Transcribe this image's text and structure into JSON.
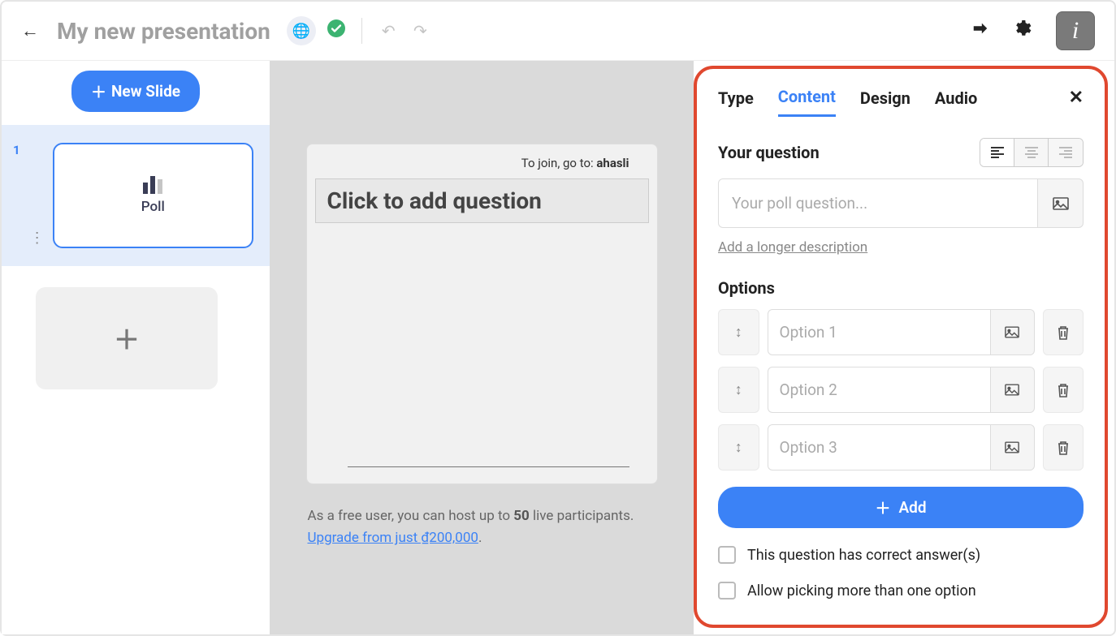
{
  "header": {
    "title": "My new presentation"
  },
  "sidebar": {
    "new_slide_label": "New Slide",
    "slide_number": "1",
    "slide_type_label": "Poll"
  },
  "canvas": {
    "join_prefix": "To join, go to: ",
    "join_link": "ahasli",
    "question_placeholder_text": "Click to add question",
    "free_text_1": "As a free user, you can host up to ",
    "free_bold": "50",
    "free_text_2": " live participants.  ",
    "upgrade_text": "Upgrade from just ₫200,000",
    "period": "."
  },
  "panel": {
    "tabs": {
      "type": "Type",
      "content": "Content",
      "design": "Design",
      "audio": "Audio"
    },
    "your_question_label": "Your question",
    "question_placeholder": "Your poll question...",
    "desc_link": "Add a longer description",
    "options_label": "Options",
    "options": [
      {
        "placeholder": "Option 1"
      },
      {
        "placeholder": "Option 2"
      },
      {
        "placeholder": "Option 3"
      }
    ],
    "add_button": "Add",
    "checkbox_correct": "This question has correct answer(s)",
    "checkbox_multi": "Allow picking more than one option"
  }
}
